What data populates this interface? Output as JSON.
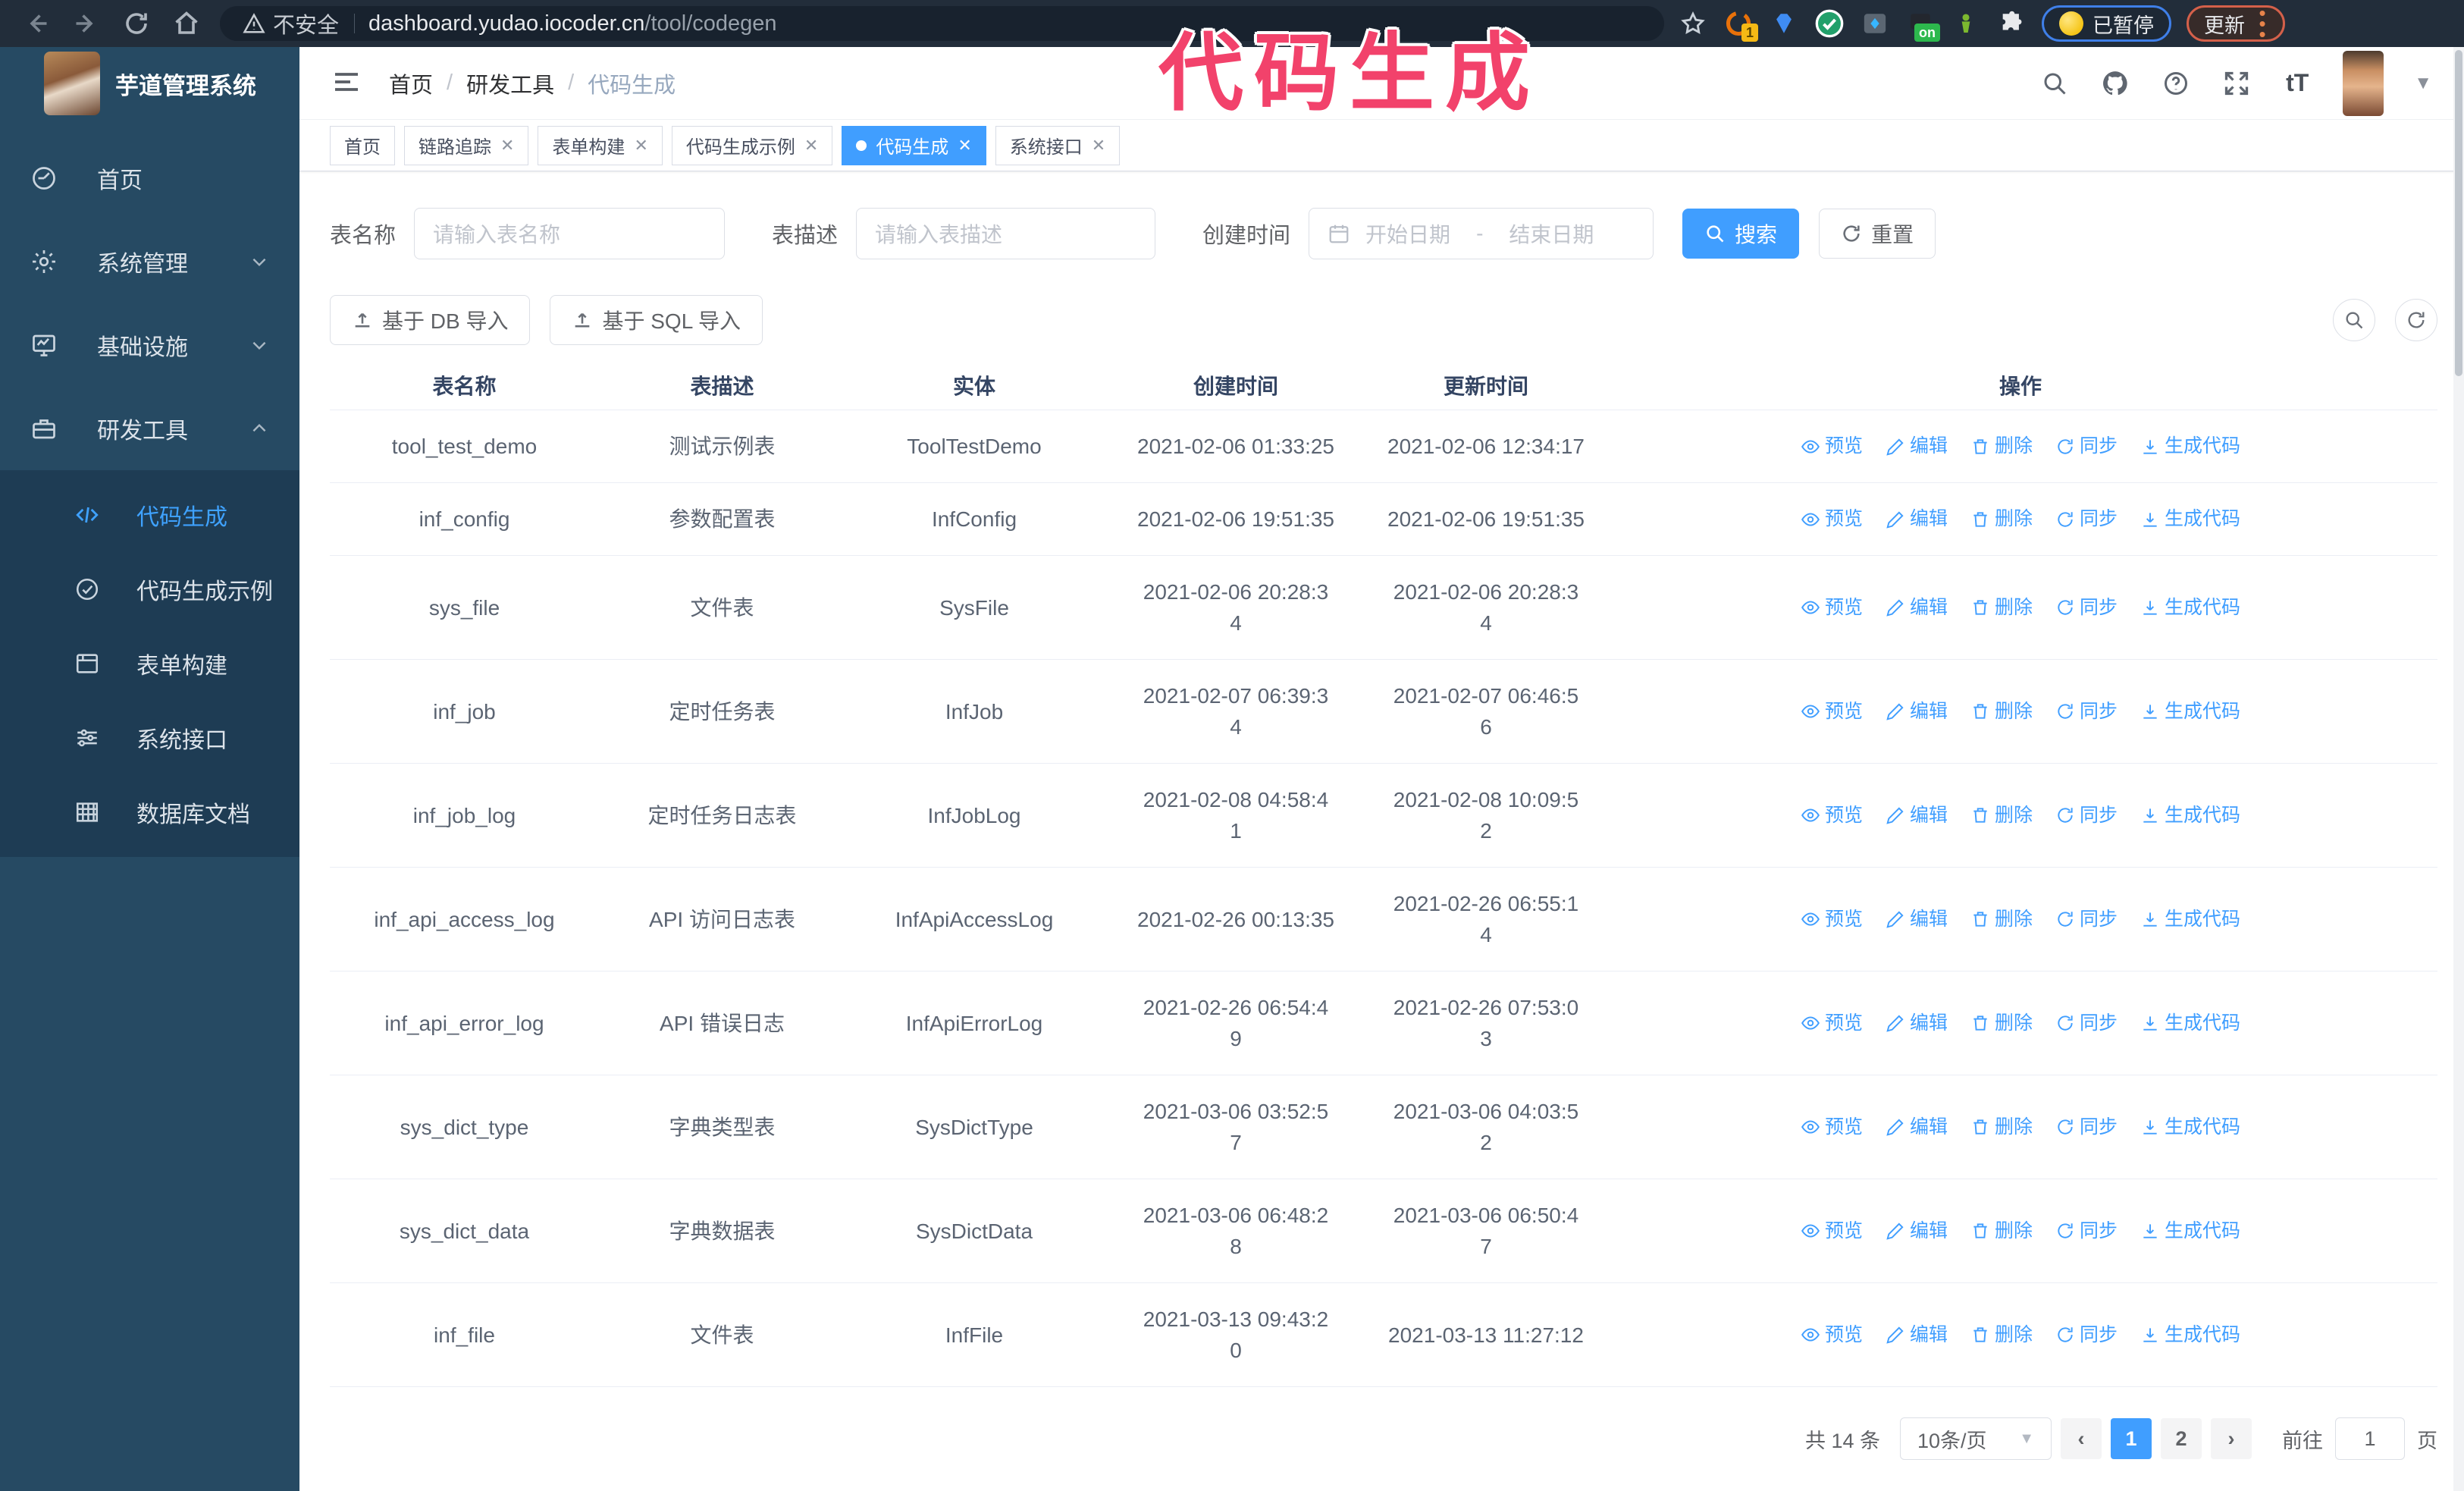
{
  "browser": {
    "security_label": "不安全",
    "url_host": "dashboard.yudao.iocoder.cn",
    "url_path": "/tool/codegen",
    "paused_label": "已暂停",
    "update_label": "更新",
    "extension_badge_1": "1",
    "extension_badge_on": "on"
  },
  "annotation": {
    "text": "代码生成",
    "color": "#f2426b"
  },
  "sidebar": {
    "title": "芋道管理系统",
    "items": [
      {
        "label": "首页"
      },
      {
        "label": "系统管理"
      },
      {
        "label": "基础设施"
      },
      {
        "label": "研发工具"
      }
    ],
    "subitems": [
      {
        "label": "代码生成",
        "active": true
      },
      {
        "label": "代码生成示例"
      },
      {
        "label": "表单构建"
      },
      {
        "label": "系统接口"
      },
      {
        "label": "数据库文档"
      }
    ]
  },
  "header": {
    "breadcrumb": [
      "首页",
      "研发工具",
      "代码生成"
    ],
    "breadcrumb_separator": "/",
    "text_size_icon_label": "tT"
  },
  "tabs": [
    {
      "label": "首页"
    },
    {
      "label": "链路追踪"
    },
    {
      "label": "表单构建"
    },
    {
      "label": "代码生成示例"
    },
    {
      "label": "代码生成",
      "active": true
    },
    {
      "label": "系统接口"
    }
  ],
  "filters": {
    "table_name_label": "表名称",
    "table_name_placeholder": "请输入表名称",
    "table_desc_label": "表描述",
    "table_desc_placeholder": "请输入表描述",
    "create_time_label": "创建时间",
    "date_start_placeholder": "开始日期",
    "date_separator": "-",
    "date_end_placeholder": "结束日期",
    "search_label": "搜索",
    "reset_label": "重置"
  },
  "toolbar": {
    "import_db_label": "基于 DB 导入",
    "import_sql_label": "基于 SQL 导入"
  },
  "table": {
    "columns": [
      "表名称",
      "表描述",
      "实体",
      "创建时间",
      "更新时间",
      "操作"
    ],
    "actions": [
      "预览",
      "编辑",
      "删除",
      "同步",
      "生成代码"
    ],
    "rows": [
      {
        "name": "tool_test_demo",
        "desc": "测试示例表",
        "entity": "ToolTestDemo",
        "created": "2021-02-06 01:33:25",
        "updated": "2021-02-06 12:34:17"
      },
      {
        "name": "inf_config",
        "desc": "参数配置表",
        "entity": "InfConfig",
        "created": "2021-02-06 19:51:35",
        "updated": "2021-02-06 19:51:35"
      },
      {
        "name": "sys_file",
        "desc": "文件表",
        "entity": "SysFile",
        "created": "2021-02-06 20:28:3\n4",
        "updated": "2021-02-06 20:28:3\n4"
      },
      {
        "name": "inf_job",
        "desc": "定时任务表",
        "entity": "InfJob",
        "created": "2021-02-07 06:39:3\n4",
        "updated": "2021-02-07 06:46:5\n6"
      },
      {
        "name": "inf_job_log",
        "desc": "定时任务日志表",
        "entity": "InfJobLog",
        "created": "2021-02-08 04:58:4\n1",
        "updated": "2021-02-08 10:09:5\n2"
      },
      {
        "name": "inf_api_access_log",
        "desc": "API 访问日志表",
        "entity": "InfApiAccessLog",
        "created": "2021-02-26 00:13:35",
        "updated": "2021-02-26 06:55:1\n4"
      },
      {
        "name": "inf_api_error_log",
        "desc": "API 错误日志",
        "entity": "InfApiErrorLog",
        "created": "2021-02-26 06:54:4\n9",
        "updated": "2021-02-26 07:53:0\n3"
      },
      {
        "name": "sys_dict_type",
        "desc": "字典类型表",
        "entity": "SysDictType",
        "created": "2021-03-06 03:52:5\n7",
        "updated": "2021-03-06 04:03:5\n2"
      },
      {
        "name": "sys_dict_data",
        "desc": "字典数据表",
        "entity": "SysDictData",
        "created": "2021-03-06 06:48:2\n8",
        "updated": "2021-03-06 06:50:4\n7"
      },
      {
        "name": "inf_file",
        "desc": "文件表",
        "entity": "InfFile",
        "created": "2021-03-13 09:43:2\n0",
        "updated": "2021-03-13 11:27:12"
      }
    ]
  },
  "pagination": {
    "total_label": "共 14 条",
    "page_size": "10条/页",
    "pages": [
      "1",
      "2"
    ],
    "active_page": "1",
    "goto_label": "前往",
    "goto_value": "1",
    "page_unit": "页"
  },
  "colors": {
    "accent": "#409eff",
    "sidebar_bg": "#264a63",
    "submenu_bg": "#1e3c54",
    "chrome_bg": "#222d3a",
    "annotation_pink": "#f2426b",
    "active_tab_bg": "#409eff"
  }
}
